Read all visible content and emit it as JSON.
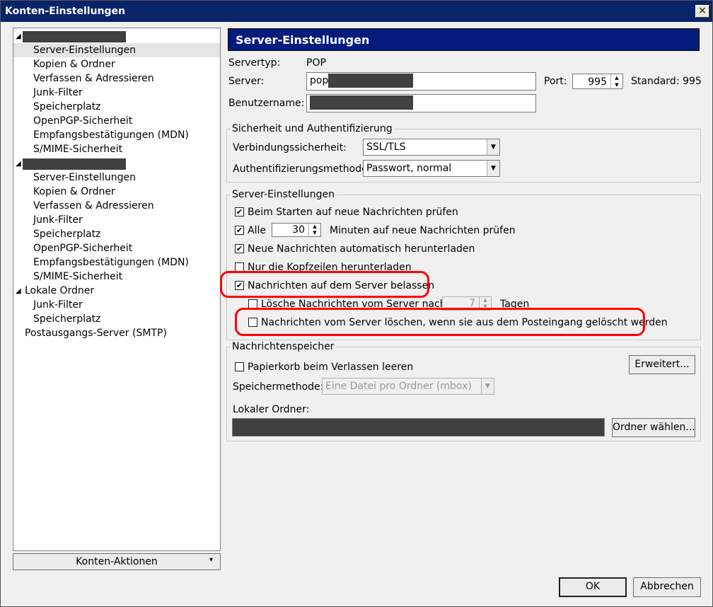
{
  "window": {
    "title": "Konten-Einstellungen",
    "close_glyph": "×"
  },
  "sidebar": {
    "items": [
      {
        "label": "Server-Einstellungen"
      },
      {
        "label": "Kopien & Ordner"
      },
      {
        "label": "Verfassen & Adressieren"
      },
      {
        "label": "Junk-Filter"
      },
      {
        "label": "Speicherplatz"
      },
      {
        "label": "OpenPGP-Sicherheit"
      },
      {
        "label": "Empfangsbestätigungen (MDN)"
      },
      {
        "label": "S/MIME-Sicherheit"
      },
      {
        "label": "Server-Einstellungen"
      },
      {
        "label": "Kopien & Ordner"
      },
      {
        "label": "Verfassen & Adressieren"
      },
      {
        "label": "Junk-Filter"
      },
      {
        "label": "Speicherplatz"
      },
      {
        "label": "OpenPGP-Sicherheit"
      },
      {
        "label": "Empfangsbestätigungen (MDN)"
      },
      {
        "label": "S/MIME-Sicherheit"
      },
      {
        "label": "Lokale Ordner"
      },
      {
        "label": "Junk-Filter"
      },
      {
        "label": "Speicherplatz"
      },
      {
        "label": "Postausgangs-Server (SMTP)"
      }
    ],
    "arrow_glyph": "◢",
    "actions_button": "Konten-Aktionen",
    "actions_dropdown_glyph": "▾"
  },
  "main": {
    "header": "Server-Einstellungen",
    "servertyp_label": "Servertyp:",
    "servertyp_value": "POP",
    "server_label": "Server:",
    "server_value": "pop",
    "port_label": "Port:",
    "port_value": "995",
    "standard_label": "Standard:",
    "standard_value": "995",
    "username_label": "Benutzername:",
    "security": {
      "title": "Sicherheit und Authentifizierung",
      "conn_label": "Verbindungssicherheit:",
      "conn_value": "SSL/TLS",
      "auth_label": "Authentifizierungsmethode:",
      "auth_value": "Passwort, normal"
    },
    "server_settings": {
      "title": "Server-Einstellungen",
      "check_new_on_start": "Beim Starten auf neue Nachrichten prüfen",
      "every_label": "Alle",
      "every_minutes_value": "30",
      "every_suffix": "Minuten auf neue Nachrichten prüfen",
      "auto_download": "Neue Nachrichten automatisch herunterladen",
      "headers_only": "Nur die Kopfzeilen herunterladen",
      "leave_on_server": "Nachrichten auf dem Server belassen",
      "delete_after_label": "Lösche Nachrichten vom Server nach",
      "delete_after_value": "7",
      "delete_after_suffix": "Tagen",
      "delete_when_deleted": "Nachrichten vom Server löschen, wenn sie aus dem Posteingang gelöscht werden",
      "check_glyph": "✔"
    },
    "storage": {
      "title": "Nachrichtenspeicher",
      "empty_trash": "Papierkorb beim Verlassen leeren",
      "advanced_button": "Erweitert...",
      "method_label": "Speichermethode:",
      "method_value": "Eine Datei pro Ordner (mbox)",
      "local_folder_label": "Lokaler Ordner:",
      "choose_folder_button": "Ordner wählen..."
    },
    "spin_glyph": "▲\n▼",
    "dropdown_glyph": "▼"
  },
  "footer": {
    "ok": "OK",
    "cancel": "Abbrechen"
  },
  "colors": {
    "header_bg": "#041c7c",
    "highlight": "#ff0000",
    "title_bar": "#0a246a"
  }
}
